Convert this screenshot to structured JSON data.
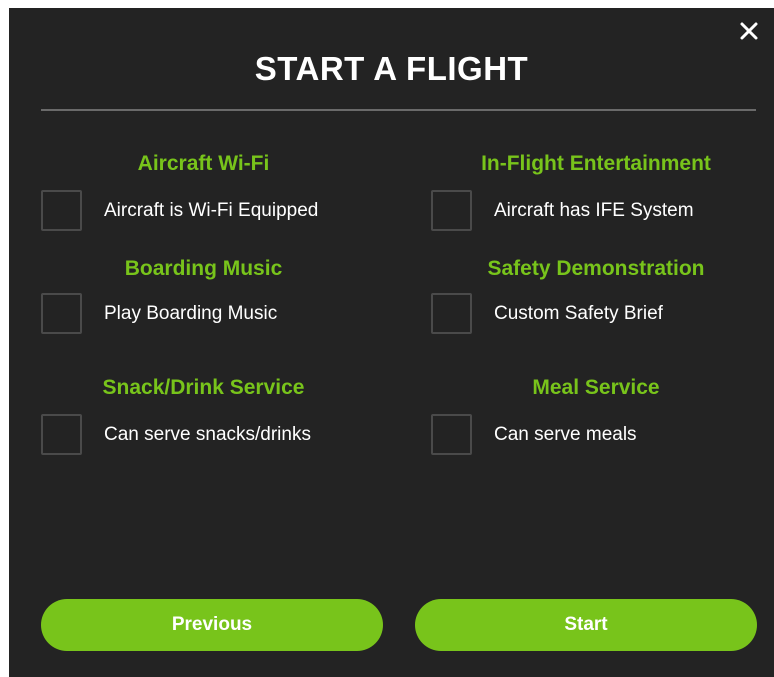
{
  "dialog": {
    "title": "START A FLIGHT",
    "close_icon": "close-icon"
  },
  "options": [
    {
      "section_title": "Aircraft Wi-Fi",
      "label": "Aircraft is Wi-Fi Equipped",
      "checked": false
    },
    {
      "section_title": "In-Flight Entertainment",
      "label": "Aircraft has IFE System",
      "checked": false
    },
    {
      "section_title": "Boarding Music",
      "label": "Play Boarding Music",
      "checked": false
    },
    {
      "section_title": "Safety Demonstration",
      "label": "Custom Safety Brief",
      "checked": false
    },
    {
      "section_title": "Snack/Drink Service",
      "label": "Can serve snacks/drinks",
      "checked": false
    },
    {
      "section_title": "Meal Service",
      "label": "Can serve meals",
      "checked": false
    }
  ],
  "buttons": {
    "previous_label": "Previous",
    "start_label": "Start"
  },
  "colors": {
    "accent": "#78c41b",
    "background": "#232323",
    "divider": "#6a6a6a"
  }
}
